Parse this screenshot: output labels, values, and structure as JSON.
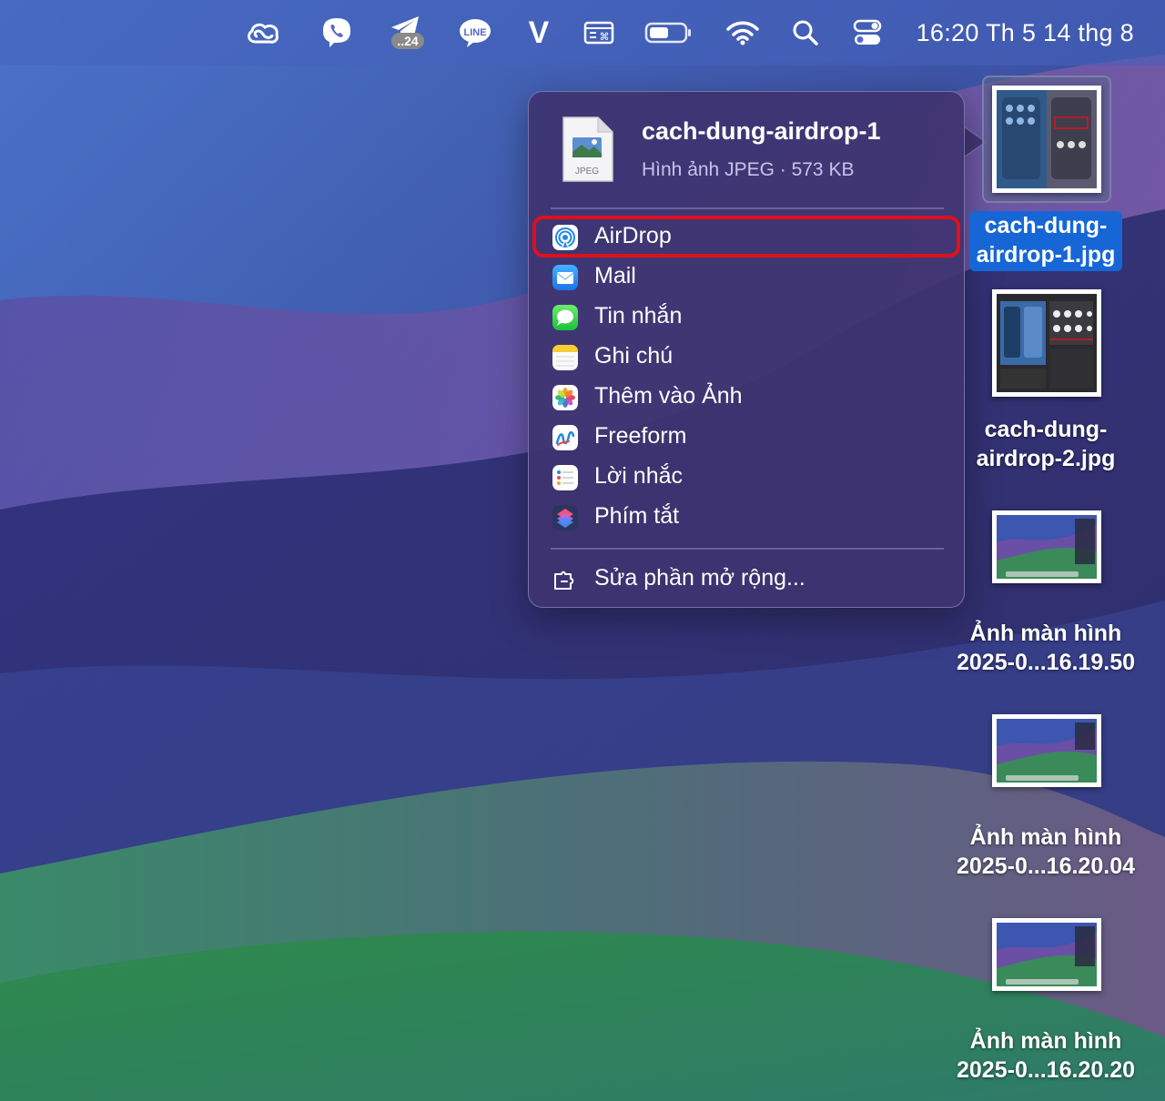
{
  "menubar": {
    "clock": "16:20 Th 5 14 thg 8",
    "telegram_badge": "..24",
    "line_label": "LINE",
    "v_label": "V",
    "icons": [
      "creative-cloud-icon",
      "viber-icon",
      "telegram-icon",
      "line-icon",
      "v-app-icon",
      "keyboard-input-icon",
      "battery-icon",
      "wifi-icon",
      "spotlight-search-icon",
      "control-center-icon"
    ]
  },
  "share_menu": {
    "file_name": "cach-dung-airdrop-1",
    "file_info": "Hình ảnh JPEG · 573 KB",
    "file_type_label": "JPEG",
    "items": [
      {
        "label": "AirDrop",
        "icon": "airdrop-icon"
      },
      {
        "label": "Mail",
        "icon": "mail-icon"
      },
      {
        "label": "Tin nhắn",
        "icon": "messages-icon"
      },
      {
        "label": "Ghi chú",
        "icon": "notes-icon"
      },
      {
        "label": "Thêm vào Ảnh",
        "icon": "photos-icon"
      },
      {
        "label": "Freeform",
        "icon": "freeform-icon"
      },
      {
        "label": "Lời nhắc",
        "icon": "reminders-icon"
      },
      {
        "label": "Phím tắt",
        "icon": "shortcuts-icon"
      }
    ],
    "edit_extensions": "Sửa phần mở rộng..."
  },
  "desktop": {
    "files": [
      {
        "line1": "cach-dung-",
        "line2": "airdrop-1.jpg",
        "selected": true
      },
      {
        "line1": "cach-dung-",
        "line2": "airdrop-2.jpg",
        "selected": false
      },
      {
        "line1": "Ảnh màn hình",
        "line2": "2025-0...16.19.50",
        "selected": false
      },
      {
        "line1": "Ảnh màn hình",
        "line2": "2025-0...16.20.04",
        "selected": false
      },
      {
        "line1": "Ảnh màn hình",
        "line2": "2025-0...16.20.20",
        "selected": false
      }
    ]
  },
  "colors": {
    "highlight_ring": "#e0101a",
    "selection_blue": "#1766d6",
    "menu_bg": "#3e3470"
  }
}
